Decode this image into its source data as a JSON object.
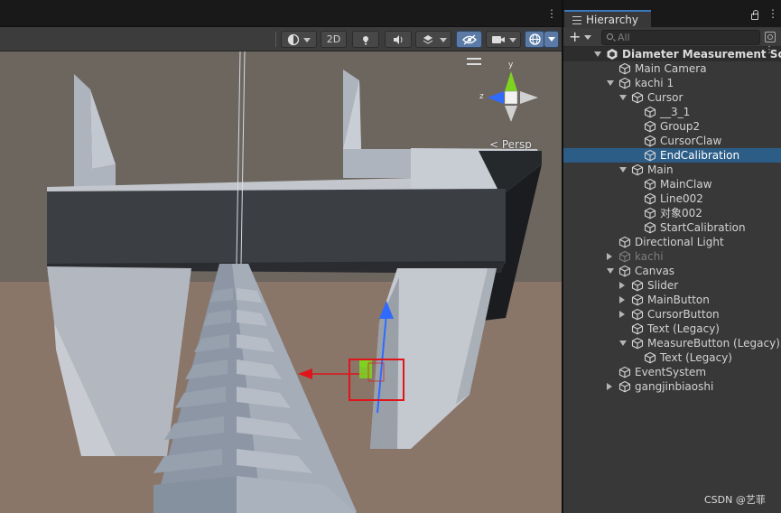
{
  "scene": {
    "toolbar": {
      "mode_2d_label": "2D"
    },
    "projection_label": "< Persp",
    "gizmo_axes": {
      "x": "x",
      "y": "y",
      "z": "z"
    }
  },
  "hierarchy": {
    "tab_label": "Hierarchy",
    "search_placeholder": "All",
    "items": [
      {
        "name": "Diameter Measurement Sc",
        "depth": 0,
        "foldout": "open",
        "kind": "scene"
      },
      {
        "name": "Main Camera",
        "depth": 1,
        "foldout": "none"
      },
      {
        "name": "kachi 1",
        "depth": 1,
        "foldout": "open"
      },
      {
        "name": "Cursor",
        "depth": 2,
        "foldout": "open"
      },
      {
        "name": "__3_1",
        "depth": 3,
        "foldout": "none"
      },
      {
        "name": "Group2",
        "depth": 3,
        "foldout": "none"
      },
      {
        "name": "CursorClaw",
        "depth": 3,
        "foldout": "none"
      },
      {
        "name": "EndCalibration",
        "depth": 3,
        "foldout": "none",
        "selected": true
      },
      {
        "name": "Main",
        "depth": 2,
        "foldout": "open"
      },
      {
        "name": "MainClaw",
        "depth": 3,
        "foldout": "none"
      },
      {
        "name": "Line002",
        "depth": 3,
        "foldout": "none"
      },
      {
        "name": "对象002",
        "depth": 3,
        "foldout": "none"
      },
      {
        "name": "StartCalibration",
        "depth": 3,
        "foldout": "none"
      },
      {
        "name": "Directional Light",
        "depth": 1,
        "foldout": "none"
      },
      {
        "name": "kachi",
        "depth": 1,
        "foldout": "closed",
        "inactive": true
      },
      {
        "name": "Canvas",
        "depth": 1,
        "foldout": "open"
      },
      {
        "name": "Slider",
        "depth": 2,
        "foldout": "closed"
      },
      {
        "name": "MainButton",
        "depth": 2,
        "foldout": "closed"
      },
      {
        "name": "CursorButton",
        "depth": 2,
        "foldout": "closed"
      },
      {
        "name": "Text (Legacy)",
        "depth": 2,
        "foldout": "none"
      },
      {
        "name": "MeasureButton (Legacy)",
        "depth": 2,
        "foldout": "open"
      },
      {
        "name": "Text (Legacy)",
        "depth": 3,
        "foldout": "none"
      },
      {
        "name": "EventSystem",
        "depth": 1,
        "foldout": "none"
      },
      {
        "name": "gangjinbiaoshi",
        "depth": 1,
        "foldout": "closed"
      }
    ]
  },
  "watermark": "CSDN @艺菲",
  "colors": {
    "selection": "#2c5d87",
    "accent": "#3a79bb",
    "gizmo_x": "#e0151b",
    "gizmo_y": "#7ed321",
    "gizmo_z": "#2f6bff",
    "highlight_box": "#e0151b"
  }
}
